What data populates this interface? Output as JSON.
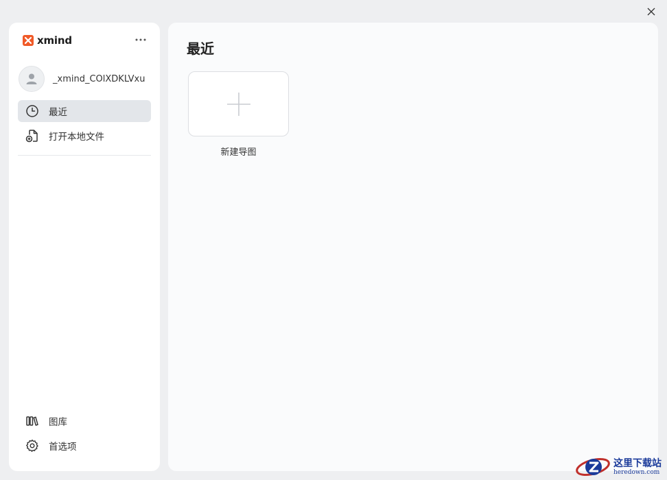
{
  "window": {
    "close_icon": "close-icon"
  },
  "sidebar": {
    "brand": {
      "name": "xmind",
      "logo_color": "#f05a28"
    },
    "more_icon": "ellipsis-icon",
    "user": {
      "name": "_xmind_COlXDKLVxu",
      "avatar_icon": "user-icon"
    },
    "nav": [
      {
        "label": "最近",
        "icon": "clock-icon",
        "active": true
      },
      {
        "label": "打开本地文件",
        "icon": "open-file-icon",
        "active": false
      }
    ],
    "bottom": [
      {
        "label": "图库",
        "icon": "library-icon"
      },
      {
        "label": "首选项",
        "icon": "gear-icon"
      }
    ]
  },
  "main": {
    "title": "最近",
    "new_card": {
      "label": "新建导图",
      "icon": "plus-icon"
    }
  },
  "watermark": {
    "cn": "这里下载站",
    "en": "heredown.com"
  }
}
